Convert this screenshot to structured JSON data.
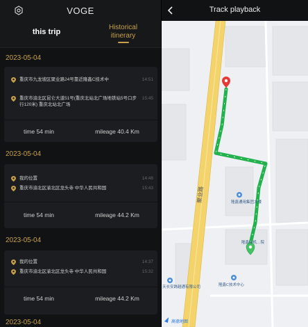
{
  "app": {
    "title": "VOGE"
  },
  "tabs": [
    {
      "label": "this trip"
    },
    {
      "label": "Historical itinerary"
    }
  ],
  "trips": [
    {
      "date": "2023-05-04",
      "locations": [
        {
          "text": "重庆市九龙坡区聚业路24号靠近隆鑫C技术中",
          "time": "14:51"
        },
        {
          "text": "重庆市渝北区昆仑大道51号(重庆北站北广场地铁站5号口步行120米) 重庆北站北广场",
          "time": "15:45"
        }
      ],
      "duration": "time 54 min",
      "mileage": "mileage 40.4 Km"
    },
    {
      "date": "2023-05-04",
      "locations": [
        {
          "text": "我的位置",
          "time": "14:48"
        },
        {
          "text": "重庆市渝北区渝北区龙头寺 中华人民共和国",
          "time": "15:43"
        }
      ],
      "duration": "time 54 min",
      "mileage": "mileage 44.2 Km"
    },
    {
      "date": "2023-05-04",
      "locations": [
        {
          "text": "我的位置",
          "time": "14:37"
        },
        {
          "text": "重庆市渝北区渝北区龙头寺 中华人民共和国",
          "time": "15:32"
        }
      ],
      "duration": "time 54 min",
      "mileage": "mileage 44.2 Km"
    },
    {
      "date": "2023-05-04"
    }
  ],
  "playback": {
    "title": "Track playback",
    "map_labels": {
      "road": "聚业路",
      "poi1": "隆鑫通用集团大楼",
      "poi2": "隆鑫动机…院",
      "poi3": "隆鑫C技术中心",
      "poi4": "天长安跨越通有限公司",
      "attribution": "高德地图"
    }
  },
  "colors": {
    "accent": "#c9a14a",
    "track": "#22b14c",
    "start_pin": "#e53935",
    "end_pin": "#43c463"
  },
  "icons": {
    "settings": "settings-icon",
    "back": "back-arrow-icon",
    "location_pin": "location-pin-icon"
  }
}
